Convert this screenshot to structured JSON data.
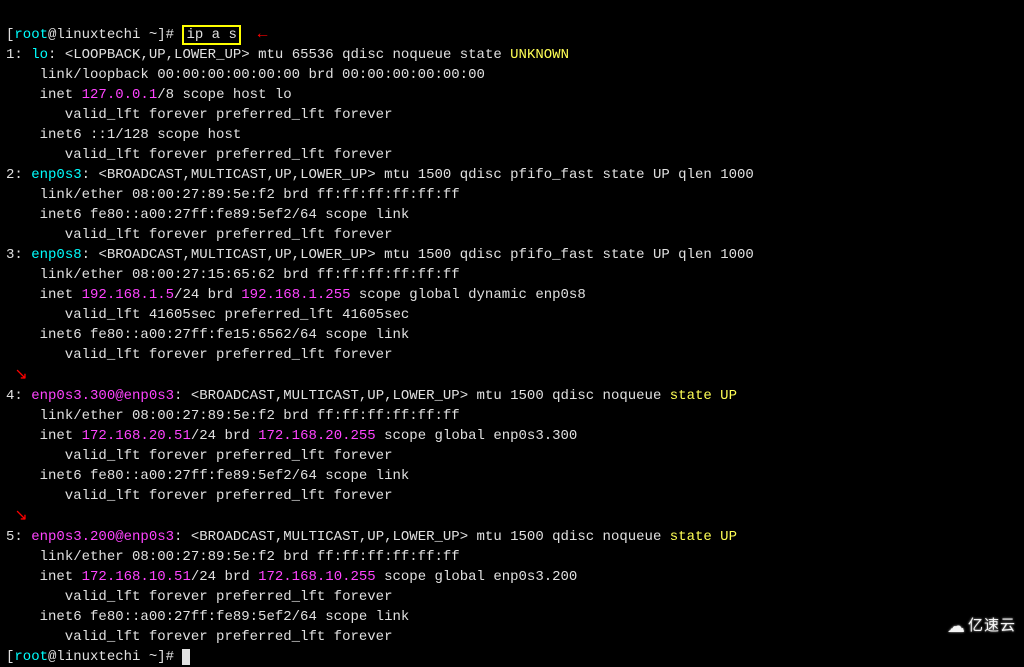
{
  "prompt": {
    "user": "root",
    "host": "linuxtechi",
    "sep": " ~",
    "hash": "#",
    "command": "ip a s"
  },
  "arrows": {
    "right": "←",
    "diag": "↘"
  },
  "ifaces": [
    {
      "index": "1",
      "name": "lo",
      "flags": "<LOOPBACK,UP,LOWER_UP>",
      "mtu": "65536",
      "qdisc": "noqueue",
      "state": "UNKNOWN",
      "stateColor": "yellow",
      "qlen": "",
      "link": "link/loopback 00:00:00:00:00:00 brd 00:00:00:00:00:00",
      "inet": {
        "ip": "127.0.0.1",
        "mask": "/8",
        "rest": " scope host lo",
        "lft": "forever",
        "plft": "forever"
      },
      "inet_extra": {
        "line": "inet6 ::1/128 scope host",
        "lft": "forever",
        "plft": "forever"
      },
      "nameColor": "cyan"
    },
    {
      "index": "2",
      "name": "enp0s3",
      "flags": "<BROADCAST,MULTICAST,UP,LOWER_UP>",
      "mtu": "1500",
      "qdisc": "pfifo_fast",
      "state": "UP",
      "stateColor": "",
      "qlen": "1000",
      "link": "link/ether 08:00:27:89:5e:f2 brd ff:ff:ff:ff:ff:ff",
      "inet6": {
        "line": "inet6 fe80::a00:27ff:fe89:5ef2/64 scope link",
        "lft": "forever",
        "plft": "forever"
      },
      "nameColor": "cyan"
    },
    {
      "index": "3",
      "name": "enp0s8",
      "flags": "<BROADCAST,MULTICAST,UP,LOWER_UP>",
      "mtu": "1500",
      "qdisc": "pfifo_fast",
      "state": "UP",
      "stateColor": "",
      "qlen": "1000",
      "link": "link/ether 08:00:27:15:65:62 brd ff:ff:ff:ff:ff:ff",
      "inet": {
        "ip": "192.168.1.5",
        "mask": "/24",
        "brd": "192.168.1.255",
        "rest": " scope global dynamic enp0s8",
        "lft": "41605sec",
        "plft": "41605sec"
      },
      "inet6": {
        "line": "inet6 fe80::a00:27ff:fe15:6562/64 scope link",
        "lft": "forever",
        "plft": "forever"
      },
      "nameColor": "cyan"
    },
    {
      "index": "4",
      "name": "enp0s3.300@enp0s3",
      "flags": "<BROADCAST,MULTICAST,UP,LOWER_UP>",
      "mtu": "1500",
      "qdisc": "noqueue",
      "statePhrase": "state UP",
      "qlen": "",
      "link": "link/ether 08:00:27:89:5e:f2 brd ff:ff:ff:ff:ff:ff",
      "inet": {
        "ip": "172.168.20.51",
        "mask": "/24",
        "brd": "172.168.20.255",
        "rest": " scope global enp0s3.300",
        "lft": "forever",
        "plft": "forever"
      },
      "inet6": {
        "line": "inet6 fe80::a00:27ff:fe89:5ef2/64 scope link",
        "lft": "forever",
        "plft": "forever"
      },
      "nameColor": "magenta"
    },
    {
      "index": "5",
      "name": "enp0s3.200@enp0s3",
      "flags": "<BROADCAST,MULTICAST,UP,LOWER_UP>",
      "mtu": "1500",
      "qdisc": "noqueue",
      "statePhrase": "state UP",
      "qlen": "",
      "link": "link/ether 08:00:27:89:5e:f2 brd ff:ff:ff:ff:ff:ff",
      "inet": {
        "ip": "172.168.10.51",
        "mask": "/24",
        "brd": "172.168.10.255",
        "rest": " scope global enp0s3.200",
        "lft": "forever",
        "plft": "forever"
      },
      "inet6": {
        "line": "inet6 fe80::a00:27ff:fe89:5ef2/64 scope link",
        "lft": "forever",
        "plft": "forever"
      },
      "nameColor": "magenta"
    }
  ],
  "watermark": "亿速云"
}
